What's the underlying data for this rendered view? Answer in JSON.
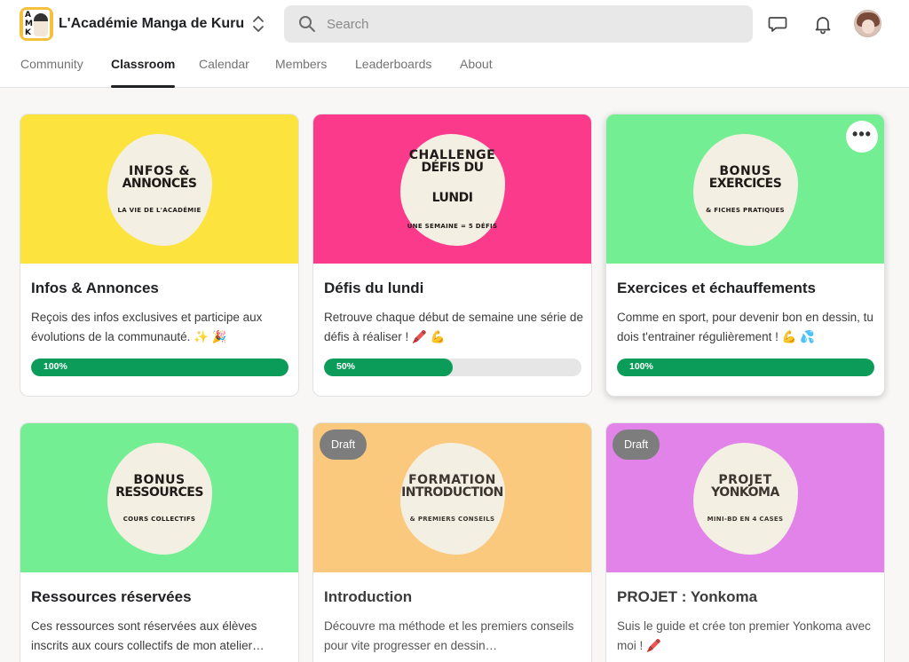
{
  "header": {
    "community_name": "L'Académie Manga de Kuru",
    "search_placeholder": "Search",
    "logo_letters": [
      "A",
      "M",
      "K"
    ]
  },
  "tabs": [
    {
      "label": "Community",
      "active": false
    },
    {
      "label": "Classroom",
      "active": true
    },
    {
      "label": "Calendar",
      "active": false
    },
    {
      "label": "Members",
      "active": false
    },
    {
      "label": "Leaderboards",
      "active": false
    },
    {
      "label": "About",
      "active": false
    }
  ],
  "icons": [
    "search-icon",
    "chat-icon",
    "bell-icon",
    "switch-community-icon",
    "more-icon"
  ],
  "colors": {
    "yellow": "#fce33d",
    "pink": "#fc3a8c",
    "green": "#74ee92",
    "orange": "#fbc97e",
    "violet": "#e283ea",
    "progress": "#0a9c58"
  },
  "courses": [
    {
      "title": "Infos & Annonces",
      "description": "Reçois des infos exclusives et participe aux évolutions de la communauté. ✨ 🎉",
      "cover_small": "INFOS &",
      "cover_big": "ANNONCES",
      "cover_big2": "",
      "cover_tag": "LA VIE DE L'ACADÉMIE",
      "color": "#fce33d",
      "progress": 100,
      "progress_label": "100%",
      "draft": false
    },
    {
      "title": "Défis du lundi",
      "description": "Retrouve chaque début de semaine une série de défis à réaliser ! 🖍️ 💪",
      "cover_small": "CHALLENGE",
      "cover_big": "DÉFIS DU",
      "cover_big2": "LUNDI",
      "cover_tag": "UNE SEMAINE = 5 DÉFIS",
      "color": "#fc3a8c",
      "progress": 50,
      "progress_label": "50%",
      "draft": false
    },
    {
      "title": "Exercices et échauffements",
      "description": "Comme en sport, pour devenir bon en dessin, tu dois t'entrainer régulièrement ! 💪 💦",
      "cover_small": "BONUS",
      "cover_big": "EXERCICES",
      "cover_big2": "",
      "cover_tag": "& FICHES PRATIQUES",
      "color": "#74ee92",
      "progress": 100,
      "progress_label": "100%",
      "draft": false
    },
    {
      "title": "Ressources réservées",
      "description": "Ces ressources sont réservées aux élèves inscrits aux cours collectifs de mon atelier…",
      "cover_small": "BONUS",
      "cover_big": "RESSOURCES",
      "cover_big2": "",
      "cover_tag": "COURS COLLECTIFS",
      "color": "#74ee92",
      "draft": false
    },
    {
      "title": "Introduction",
      "description": "Découvre ma méthode et les premiers conseils pour vite progresser en dessin…",
      "cover_small": "FORMATION",
      "cover_big": "INTRODUCTION",
      "cover_big2": "",
      "cover_tag": "& PREMIERS CONSEILS",
      "color": "#fbc97e",
      "draft": true,
      "draft_label": "Draft"
    },
    {
      "title": "PROJET : Yonkoma",
      "description": "Suis le guide et crée ton premier Yonkoma avec moi ! 🖍️",
      "cover_small": "PROJET",
      "cover_big": "YONKOMA",
      "cover_big2": "",
      "cover_tag": "MINI-BD EN 4 CASES",
      "color": "#e283ea",
      "draft": true,
      "draft_label": "Draft"
    }
  ]
}
